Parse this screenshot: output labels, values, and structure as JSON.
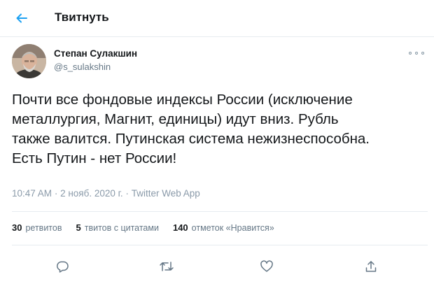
{
  "header": {
    "title": "Твитнуть",
    "back_icon": "arrow-left-icon",
    "accent": "#1da1f2"
  },
  "tweet": {
    "author": {
      "name": "Степан Сулакшин",
      "handle": "@s_sulakshin"
    },
    "text": "Почти все фондовые индексы России (исключение\nметаллургия, Магнит, единицы) идут вниз. Рубль\nтакже валится. Путинская система нежизнеспособна.\nЕсть Путин - нет России!",
    "time": "10:47 AM",
    "date": "2 нояб. 2020 г.",
    "separator": "·",
    "app": "Twitter Web App"
  },
  "stats": {
    "retweets_count": "30",
    "retweets_label": "ретвитов",
    "quotes_count": "5",
    "quotes_label": "твитов с цитатами",
    "likes_count": "140",
    "likes_label": "отметок «Нравится»"
  },
  "actions": [
    "reply-icon",
    "retweet-icon",
    "like-icon",
    "share-icon"
  ]
}
